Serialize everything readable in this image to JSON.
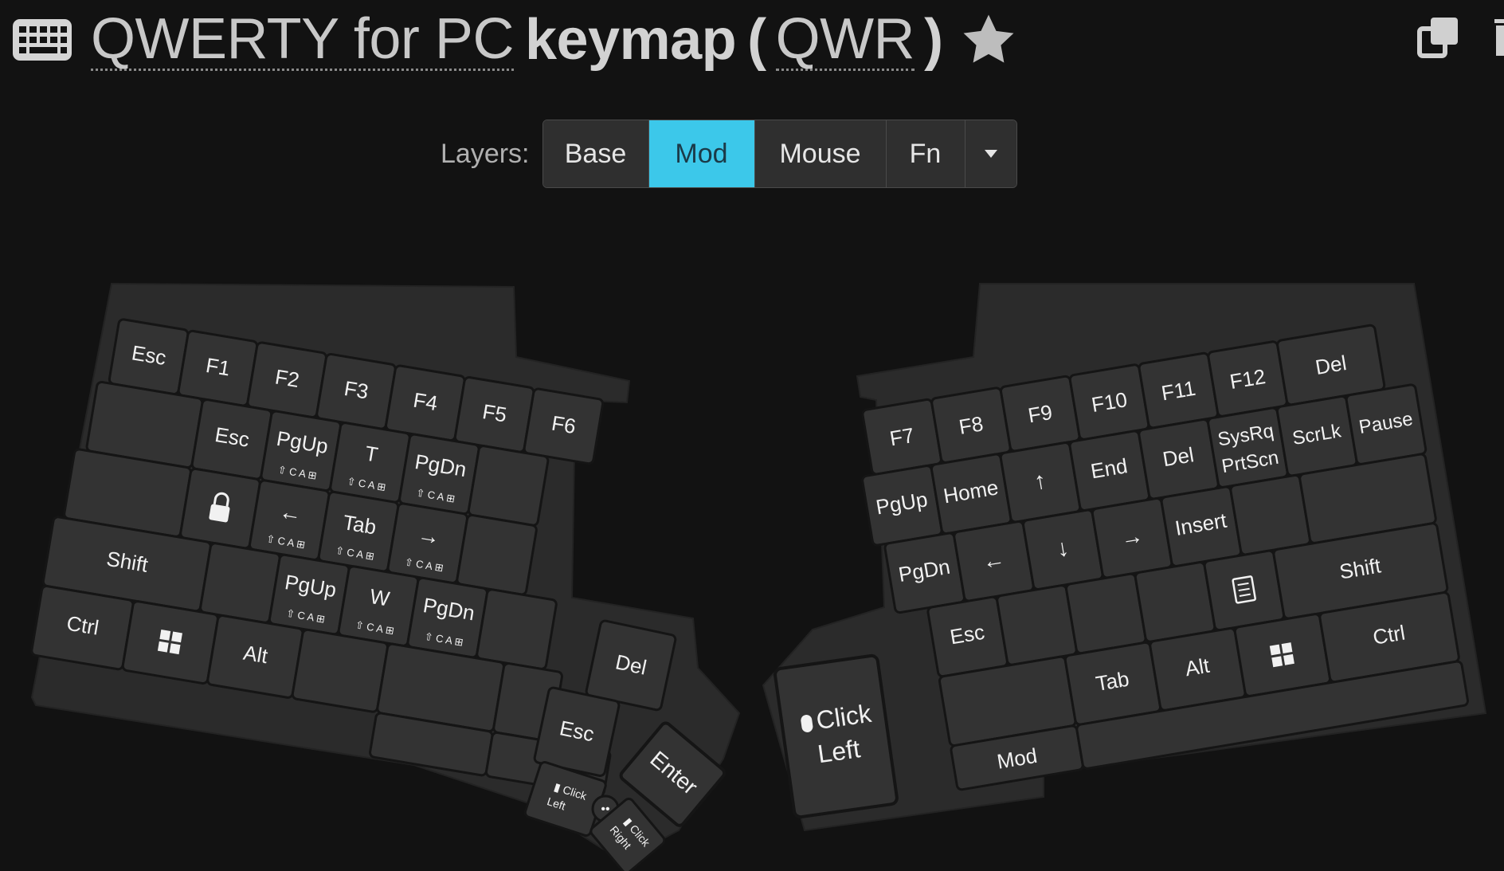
{
  "header": {
    "layout_name": "QWERTY for PC",
    "keymap_word": "keymap",
    "open_paren": "(",
    "close_paren": ")",
    "layout_code": "QWR",
    "icons": [
      "keyboard-icon",
      "star-icon",
      "copy-icon",
      "trash-icon"
    ]
  },
  "layers": {
    "label": "Layers:",
    "buttons": [
      "Base",
      "Mod",
      "Mouse",
      "Fn"
    ],
    "active": "Mod",
    "dropdown_icon": "caret-down-icon"
  },
  "colors": {
    "background": "#121212",
    "case": "#2b2b2b",
    "key": "#333333",
    "key_border": "#151515",
    "accent": "#3cc8ea"
  },
  "mod_legend": [
    "⇧",
    "C",
    "A",
    "⊞"
  ],
  "left_keys": {
    "esc_top": "Esc",
    "f1": "F1",
    "f2": "F2",
    "f3": "F3",
    "f4": "F4",
    "f5": "F5",
    "f6": "F6",
    "esc": "Esc",
    "pgup": "PgUp",
    "t": "T",
    "pgdn": "PgDn",
    "lock": "lock-icon",
    "left": "←",
    "tab": "Tab",
    "right": "→",
    "shift": "Shift",
    "pgup2": "PgUp",
    "w": "W",
    "pgdn2": "PgDn",
    "ctrl": "Ctrl",
    "win": "windows-icon",
    "alt": "Alt",
    "del": "Del",
    "esc_thumb": "Esc",
    "enter": "Enter",
    "click_left": "Click Left",
    "click_right": "Click Right",
    "middle": "••"
  },
  "right_keys": {
    "f7": "F7",
    "f8": "F8",
    "f9": "F9",
    "f10": "F10",
    "f11": "F11",
    "f12": "F12",
    "del_top": "Del",
    "pgup": "PgUp",
    "home": "Home",
    "up": "↑",
    "end": "End",
    "del": "Del",
    "sysrq": "SysRq",
    "prtscn": "PrtScn",
    "scrlk": "ScrLk",
    "pause": "Pause",
    "pgdn": "PgDn",
    "left": "←",
    "down": "↓",
    "right": "→",
    "insert": "Insert",
    "menu": "menu-icon",
    "shift": "Shift",
    "esc": "Esc",
    "tab": "Tab",
    "alt": "Alt",
    "win": "windows-icon",
    "ctrl": "Ctrl",
    "click": "Click",
    "left_word": "Left",
    "mod": "Mod"
  }
}
